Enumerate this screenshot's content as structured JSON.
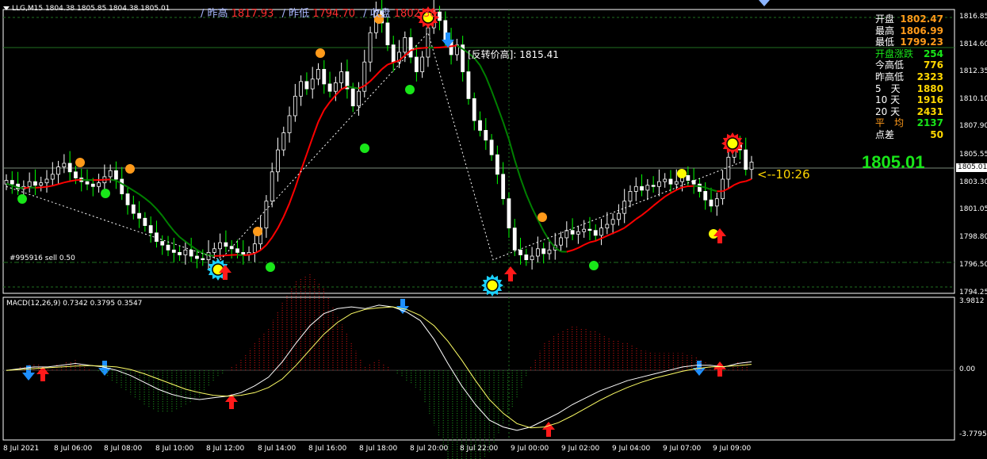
{
  "header": {
    "symbol_line": "LLG,M15  1804.38 1805.85 1804.38 1805.01"
  },
  "top_info": [
    {
      "label": "/ 昨高",
      "value": "1817.93"
    },
    {
      "label": "/ 昨低",
      "value": "1794.70"
    },
    {
      "label": "/ 收盘",
      "value": "1802.38"
    }
  ],
  "stats_panel": [
    {
      "label": "开盘",
      "value": "1802.47",
      "label_color": "#ffffff",
      "value_color": "#ff9a1a"
    },
    {
      "label": "最高",
      "value": "1806.99",
      "label_color": "#ffffff",
      "value_color": "#ff9a1a"
    },
    {
      "label": "最低",
      "value": "1799.23",
      "label_color": "#ffffff",
      "value_color": "#ff9a1a"
    },
    {
      "label": "开盘涨跌",
      "value": "254",
      "label_color": "#19e619",
      "value_color": "#19e619"
    },
    {
      "label": "今高低",
      "value": "776",
      "label_color": "#ffffff",
      "value_color": "#ffd700"
    },
    {
      "label": "昨高低",
      "value": "2323",
      "label_color": "#ffffff",
      "value_color": "#ffd700"
    },
    {
      "label": "5　天",
      "value": "1880",
      "label_color": "#ffffff",
      "value_color": "#ffd700"
    },
    {
      "label": "10 天",
      "value": "1916",
      "label_color": "#ffffff",
      "value_color": "#ffd700"
    },
    {
      "label": "20 天",
      "value": "2431",
      "label_color": "#ffffff",
      "value_color": "#ffd700"
    },
    {
      "label": "平　均",
      "value": "2137",
      "label_color": "#ff9a1a",
      "value_color": "#19e619"
    },
    {
      "label": "点差",
      "value": "50",
      "label_color": "#ffffff",
      "value_color": "#ffd700"
    }
  ],
  "current_price": "1805.01",
  "countdown": "<--10:26",
  "reversal_label": "[反转价高]: 1815.41",
  "order_label": "#995916 sell 0.50",
  "macd_label": "MACD(12,26,9) 0.7342 0.3795 0.3547",
  "price_axis": [
    "1816.85",
    "1814.60",
    "1812.35",
    "1810.10",
    "1807.90",
    "1805.55",
    "1803.30",
    "1801.05",
    "1798.80",
    "1796.50",
    "1794.25"
  ],
  "macd_axis": [
    "3.9812",
    "0.00",
    "-3.7795"
  ],
  "time_axis": [
    "8 Jul 2021",
    "8 Jul 06:00",
    "8 Jul 08:00",
    "8 Jul 10:00",
    "8 Jul 12:00",
    "8 Jul 14:00",
    "8 Jul 16:00",
    "8 Jul 18:00",
    "8 Jul 20:00",
    "8 Jul 22:00",
    "9 Jul 00:00",
    "9 Jul 02:00",
    "9 Jul 04:00",
    "9 Jul 07:00",
    "9 Jul 09:00"
  ],
  "price_series": [
    1803.5,
    1803.2,
    1802.8,
    1803.0,
    1803.4,
    1803.1,
    1803.3,
    1803.6,
    1804.0,
    1804.6,
    1804.9,
    1804.2,
    1803.7,
    1803.4,
    1803.2,
    1803.0,
    1803.3,
    1803.8,
    1804.3,
    1803.6,
    1802.4,
    1801.5,
    1800.8,
    1800.4,
    1799.8,
    1799.2,
    1798.5,
    1798.2,
    1797.8,
    1797.6,
    1797.4,
    1797.8,
    1797.3,
    1797.1,
    1797.0,
    1797.6,
    1797.9,
    1798.4,
    1798.1,
    1797.9,
    1797.6,
    1797.4,
    1797.6,
    1798.3,
    1799.6,
    1801.8,
    1804.2,
    1806.0,
    1807.4,
    1808.8,
    1810.4,
    1811.6,
    1811.0,
    1811.8,
    1812.6,
    1811.4,
    1810.8,
    1811.5,
    1812.4,
    1811.0,
    1809.6,
    1810.8,
    1813.2,
    1815.6,
    1817.4,
    1816.4,
    1814.6,
    1813.2,
    1814.0,
    1815.2,
    1813.6,
    1812.4,
    1813.6,
    1816.0,
    1817.3,
    1816.6,
    1815.0,
    1813.8,
    1814.6,
    1812.4,
    1810.2,
    1808.4,
    1807.6,
    1806.8,
    1805.6,
    1804.0,
    1802.0,
    1799.6,
    1797.8,
    1797.4,
    1797.0,
    1797.3,
    1797.9,
    1797.5,
    1797.8,
    1798.2,
    1798.8,
    1799.4,
    1799.1,
    1799.3,
    1799.5,
    1799.4,
    1799.0,
    1799.6,
    1799.9,
    1800.3,
    1800.8,
    1801.8,
    1802.6,
    1803.0,
    1802.7,
    1803.1,
    1803.0,
    1803.4,
    1803.6,
    1803.2,
    1803.4,
    1803.9,
    1803.5,
    1803.2,
    1802.6,
    1801.9,
    1801.4,
    1802.0,
    1803.6,
    1805.4,
    1806.4,
    1806.0,
    1804.4,
    1805.0
  ],
  "macd_series": [
    0.0,
    0.1,
    0.2,
    0.2,
    0.3,
    0.4,
    0.3,
    0.2,
    0.0,
    -0.3,
    -0.7,
    -1.1,
    -1.4,
    -1.6,
    -1.7,
    -1.6,
    -1.5,
    -1.3,
    -0.9,
    -0.4,
    0.5,
    1.6,
    2.6,
    3.3,
    3.6,
    3.7,
    3.6,
    3.8,
    3.7,
    3.4,
    2.9,
    1.8,
    0.4,
    -0.9,
    -2.0,
    -2.9,
    -3.3,
    -3.5,
    -3.3,
    -2.9,
    -2.5,
    -2.0,
    -1.6,
    -1.2,
    -0.9,
    -0.6,
    -0.4,
    -0.2,
    0.0,
    0.2,
    0.3,
    0.3,
    0.2,
    0.4,
    0.5
  ],
  "signal_series": [
    0.0,
    0.05,
    0.1,
    0.15,
    0.2,
    0.25,
    0.28,
    0.25,
    0.2,
    0.05,
    -0.2,
    -0.5,
    -0.8,
    -1.1,
    -1.3,
    -1.45,
    -1.5,
    -1.45,
    -1.3,
    -1.0,
    -0.5,
    0.3,
    1.2,
    2.1,
    2.8,
    3.3,
    3.55,
    3.65,
    3.7,
    3.55,
    3.2,
    2.6,
    1.7,
    0.6,
    -0.6,
    -1.7,
    -2.5,
    -3.1,
    -3.35,
    -3.3,
    -3.05,
    -2.65,
    -2.2,
    -1.75,
    -1.35,
    -1.0,
    -0.7,
    -0.45,
    -0.25,
    -0.05,
    0.1,
    0.2,
    0.22,
    0.28,
    0.35
  ],
  "colors": {
    "bull_candle": "#ffffff",
    "bear_candle": "#00ff00",
    "ma_up": "#ff0000",
    "ma_down": "#008000",
    "grid": "#1f6f1f",
    "accent_gold": "#ffd700"
  },
  "icons": [
    "buy-arrow-icon",
    "sell-arrow-icon",
    "star-burst-icon",
    "signal-dot-icon"
  ]
}
